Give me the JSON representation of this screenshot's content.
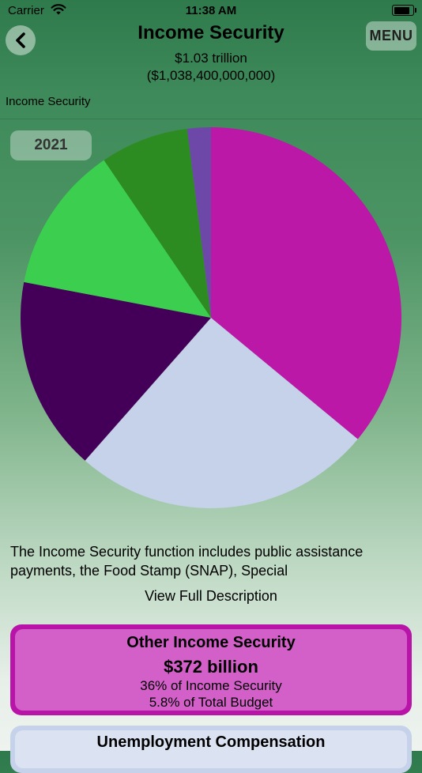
{
  "status": {
    "carrier": "Carrier",
    "time": "11:38 AM",
    "battery_level": 0.95
  },
  "header": {
    "title": "Income Security",
    "total_short": "$1.03 trillion",
    "total_long": "($1,038,400,000,000)",
    "menu_label": "MENU",
    "breadcrumb": "Income Security"
  },
  "year": "2021",
  "chart_data": {
    "type": "pie",
    "unit": "percent of Income Security",
    "slices": [
      {
        "name": "Other Income Security",
        "value": 36.0,
        "color": "#bb18a8"
      },
      {
        "name": "",
        "value": 25.5,
        "color": "#c5d2e9"
      },
      {
        "name": "",
        "value": 16.5,
        "color": "#440058"
      },
      {
        "name": "Unemployment Compensation",
        "value": 12.5,
        "color": "#3cce4e"
      },
      {
        "name": "",
        "value": 7.5,
        "color": "#2c8c22"
      },
      {
        "name": "",
        "value": 2.0,
        "color": "#6e48a8"
      }
    ]
  },
  "description": "The Income Security function includes public assistance payments, the Food Stamp (SNAP), Special",
  "view_full_label": "View Full Description",
  "cards": [
    {
      "title": "Other Income Security",
      "value": "$372 billion",
      "share_of_function": "36% of Income Security",
      "share_of_budget": "5.8% of Total Budget"
    },
    {
      "title": "Unemployment Compensation"
    }
  ]
}
